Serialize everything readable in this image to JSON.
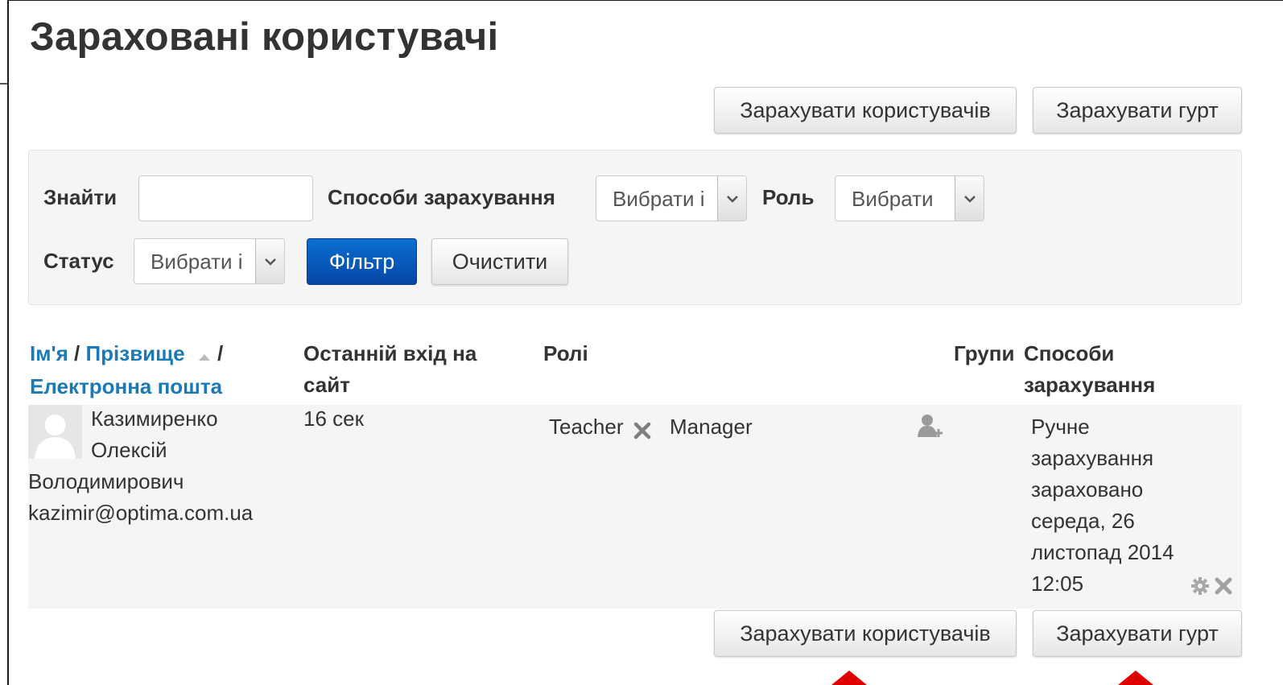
{
  "page": {
    "title": "Зараховані користувачі"
  },
  "buttons": {
    "enrol_users": "Зарахувати користувачів",
    "enrol_cohort": "Зарахувати гурт"
  },
  "filters": {
    "search_label": "Знайти",
    "search_value": "",
    "methods_label": "Способи зарахування",
    "methods_selected": "Вибрати і",
    "role_label": "Роль",
    "role_selected": "Вибрати",
    "status_label": "Статус",
    "status_selected": "Вибрати і",
    "filter_button": "Фільтр",
    "clear_button": "Очистити"
  },
  "table": {
    "headers": {
      "first_name": "Ім'я",
      "sep1": " / ",
      "surname": "Прізвище",
      "sep2": " /",
      "email": "Електронна пошта",
      "last_access_1": "Останній вхід на",
      "last_access_2": "сайт",
      "roles": "Ролі",
      "groups": "Групи",
      "methods_1": "Способи",
      "methods_2": "зарахування"
    },
    "rows": [
      {
        "name_1": "Казимиренко",
        "name_2": "Олексій",
        "name_3": "Володимирович",
        "email": "kazimir@optima.com.ua",
        "last_access": "16 сек",
        "role_1": "Teacher",
        "role_2": "Manager",
        "method_1": "Ручне",
        "method_2": "зарахування",
        "method_3": "зараховано",
        "method_4": "середа, 26",
        "method_5": "листопад 2014",
        "method_6": "12:05"
      }
    ]
  },
  "colors": {
    "accent": "#1a7ab5",
    "primary": "#0747a6",
    "arrow": "#e00000"
  }
}
